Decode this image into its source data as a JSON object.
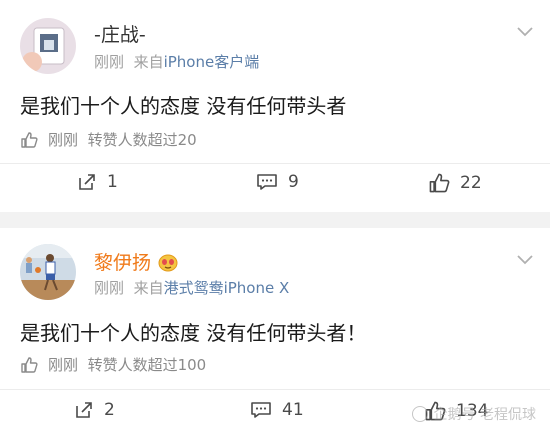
{
  "posts": [
    {
      "author": "-庄战-",
      "time": "刚刚",
      "source_prefix": "来自",
      "source": "iPhone客户端",
      "text": "是我们十个人的态度 没有任何带头者",
      "like_time": "刚刚",
      "like_text": "转赞人数超过20",
      "repost_count": "1",
      "comment_count": "9",
      "like_count": "22"
    },
    {
      "author": "黎伊扬",
      "time": "刚刚",
      "source_prefix": "来自",
      "source": "港式鸳鸯iPhone X",
      "text": "是我们十个人的态度 没有任何带头者！",
      "like_time": "刚刚",
      "like_text": "转赞人数超过100",
      "repost_count": "2",
      "comment_count": "41",
      "like_count": "134"
    }
  ],
  "watermark": "企鹅号 老程侃球",
  "colors": {
    "author1": "#333333",
    "author2": "#f07a1a",
    "link": "#5b7ea8",
    "muted": "#a0a0a0"
  }
}
